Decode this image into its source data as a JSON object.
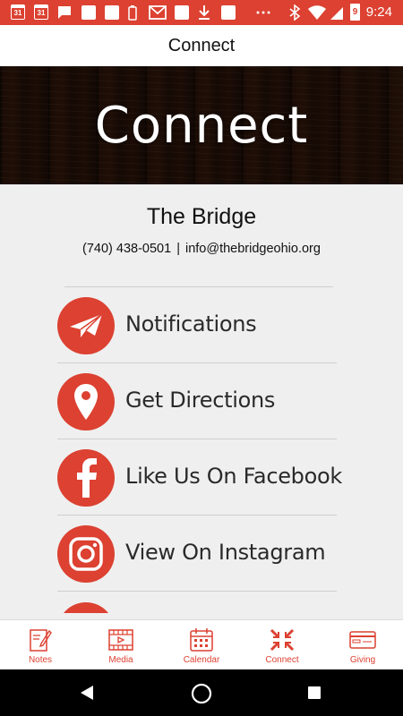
{
  "status_bar": {
    "time": "9:24",
    "calendar_day_1": "31",
    "calendar_day_2": "31",
    "battery_level": "9",
    "icons": [
      "calendar-icon",
      "calendar-icon",
      "message-icon",
      "square-icon",
      "square-icon",
      "battery-icon",
      "gmail-icon",
      "square-icon",
      "download-icon",
      "square-icon",
      "more-icon",
      "bluetooth-icon",
      "wifi-icon",
      "signal-icon",
      "battery-icon"
    ]
  },
  "app_bar": {
    "title": "Connect"
  },
  "hero": {
    "title": "Connect"
  },
  "org": {
    "name": "The Bridge",
    "phone": "(740) 438-0501",
    "separator": "|",
    "email": "info@thebridgeohio.org"
  },
  "menu": {
    "items": [
      {
        "label": "Notifications",
        "icon": "paper-plane-icon"
      },
      {
        "label": "Get Directions",
        "icon": "map-pin-icon"
      },
      {
        "label": "Like Us On Facebook",
        "icon": "facebook-icon"
      },
      {
        "label": "View On Instagram",
        "icon": "instagram-icon"
      }
    ]
  },
  "tabs": [
    {
      "label": "Notes",
      "icon": "notes-icon"
    },
    {
      "label": "Media",
      "icon": "media-icon"
    },
    {
      "label": "Calendar",
      "icon": "calendar-icon"
    },
    {
      "label": "Connect",
      "icon": "connect-icon"
    },
    {
      "label": "Giving",
      "icon": "giving-icon"
    }
  ],
  "colors": {
    "accent": "#dc4131",
    "background": "#efefef",
    "nav_bar": "#000000"
  }
}
